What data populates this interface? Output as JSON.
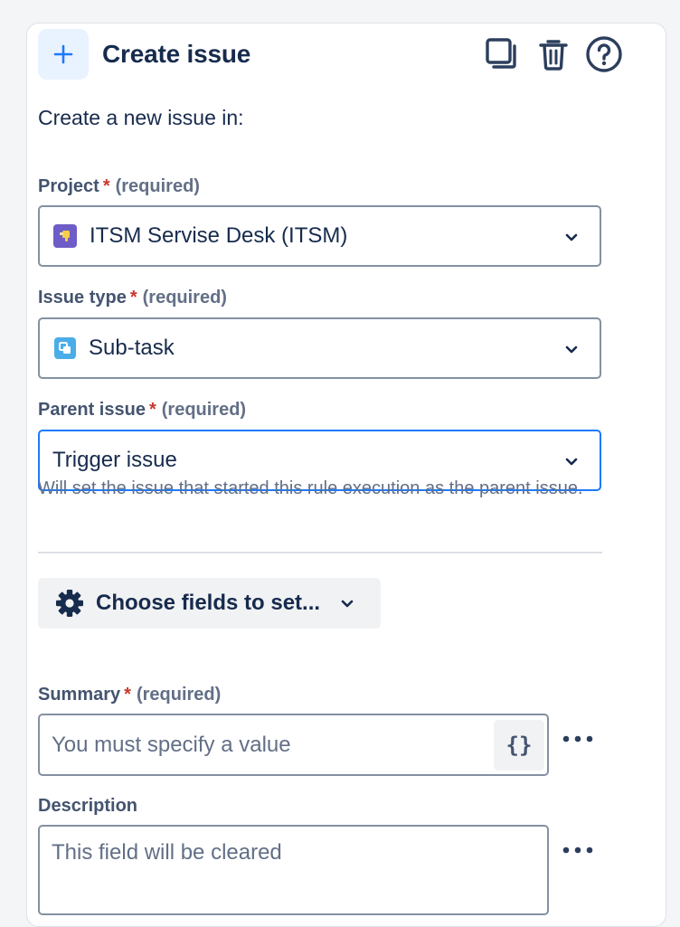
{
  "header": {
    "title": "Create issue",
    "icons": {
      "add": "plus-icon",
      "duplicate": "copy-icon",
      "delete": "trash-icon",
      "help": "help-circle-icon"
    }
  },
  "intro_text": "Create a new issue in:",
  "required_text": "(required)",
  "required_star": "*",
  "fields": {
    "project": {
      "label": "Project",
      "value": "ITSM Servise Desk (ITSM)",
      "icon": "project-avatar-icon"
    },
    "issue_type": {
      "label": "Issue type",
      "value": "Sub-task",
      "icon": "subtask-icon"
    },
    "parent_issue": {
      "label": "Parent issue",
      "value": "Trigger issue",
      "help": "Will set the issue that started this rule execution as the parent issue."
    }
  },
  "choose_fields": {
    "label": "Choose fields to set...",
    "icon": "gear-icon"
  },
  "summary": {
    "label": "Summary",
    "placeholder": "You must specify a value",
    "var_button": "{}"
  },
  "description": {
    "label": "Description",
    "placeholder": "This field will be cleared"
  },
  "colors": {
    "brand_blue": "#1d7afc",
    "required_red": "#c9372c",
    "text": "#172b4d",
    "subtle_text": "#626f86",
    "border": "#8590a2",
    "project_avatar": "#6e5dc6",
    "subtask_icon": "#4bade8"
  }
}
